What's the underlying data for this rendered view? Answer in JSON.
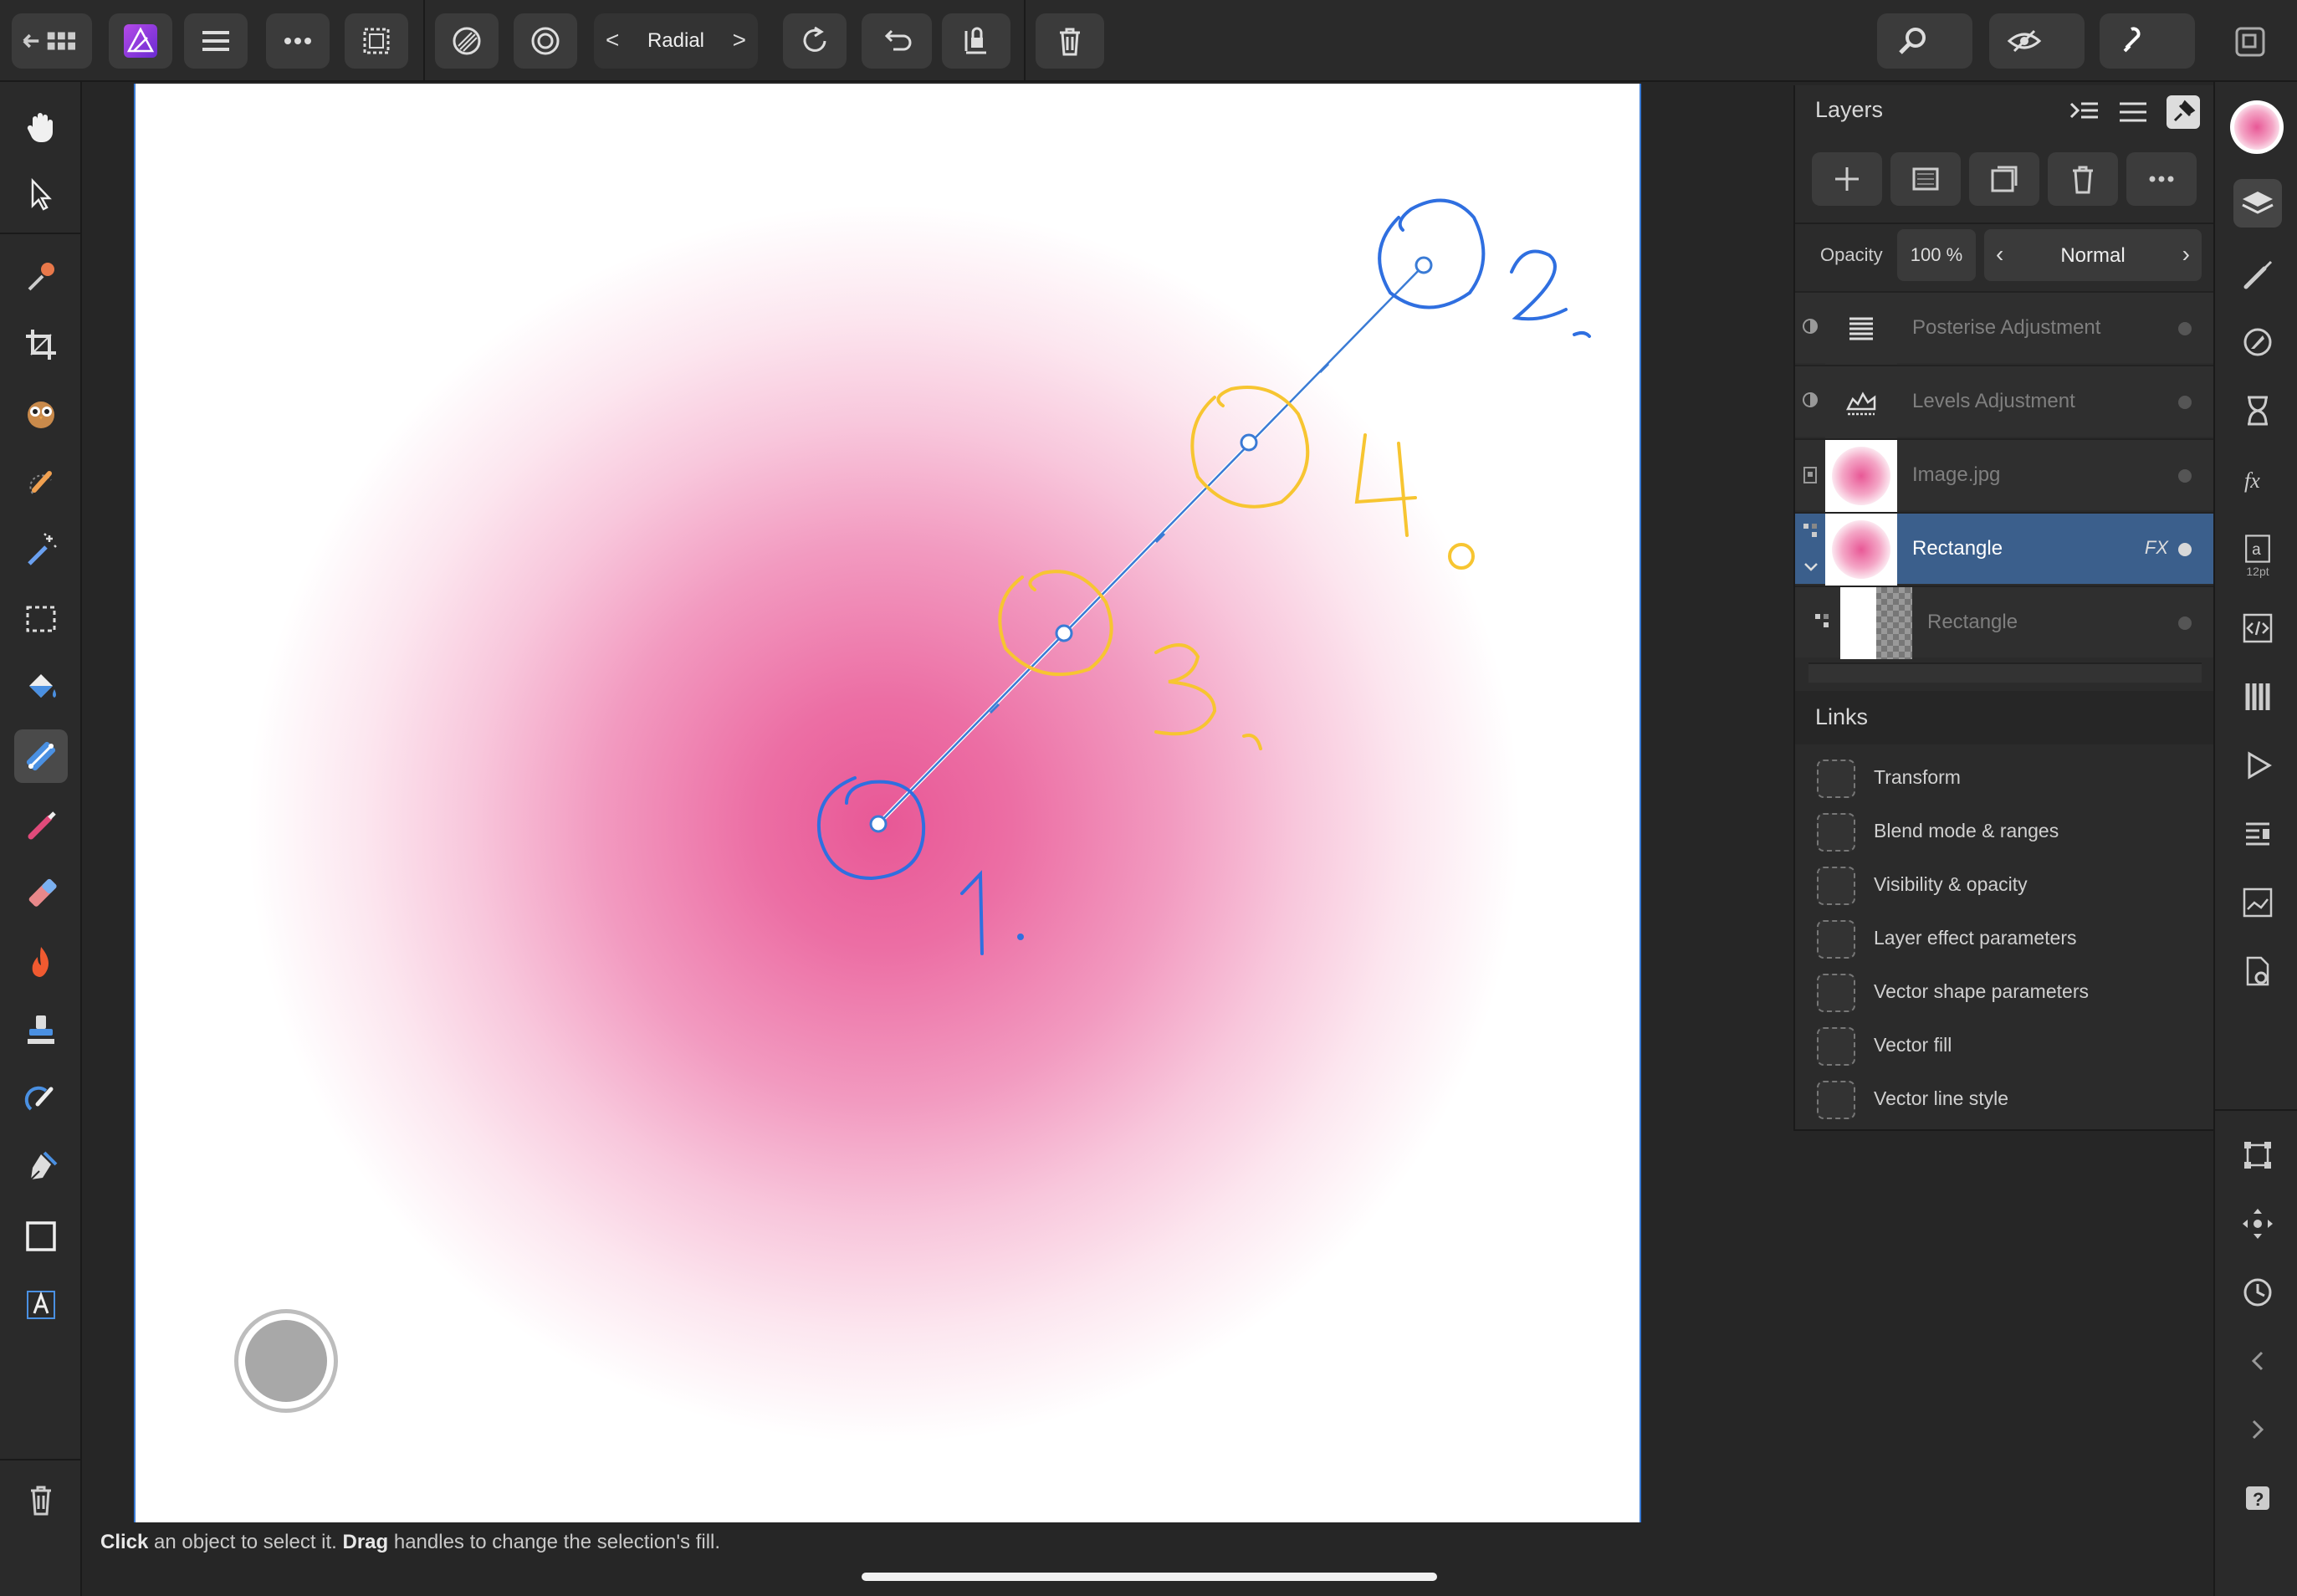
{
  "toolbar": {
    "gradient_type": "Radial",
    "prev_label": "<",
    "next_label": ">"
  },
  "layers_panel": {
    "title": "Layers",
    "opacity_label": "Opacity",
    "opacity_value": "100 %",
    "blend_mode": "Normal",
    "layers": [
      {
        "name": "Posterise Adjustment"
      },
      {
        "name": "Levels Adjustment"
      },
      {
        "name": "Image.jpg"
      },
      {
        "name": "Rectangle",
        "fx": "FX"
      },
      {
        "name": "Rectangle"
      }
    ]
  },
  "links_panel": {
    "title": "Links",
    "items": [
      "Transform",
      "Blend mode & ranges",
      "Visibility & opacity",
      "Layer effect parameters",
      "Vector shape parameters",
      "Vector fill",
      "Vector line style"
    ]
  },
  "right_strip": {
    "text_size_label": "12pt"
  },
  "status": {
    "click_word": "Click",
    "click_text": " an object to select it. ",
    "drag_word": "Drag",
    "drag_text": " handles to change the selection's fill."
  },
  "annotations": [
    "1.",
    "2.",
    "3.",
    "4."
  ],
  "colors": {
    "accent_blue": "#3a7bd5",
    "selection_row": "#3b5f8c",
    "gradient_center": "#e85896",
    "annotation_blue": "#2f6fe0",
    "annotation_yellow": "#f7c531"
  }
}
